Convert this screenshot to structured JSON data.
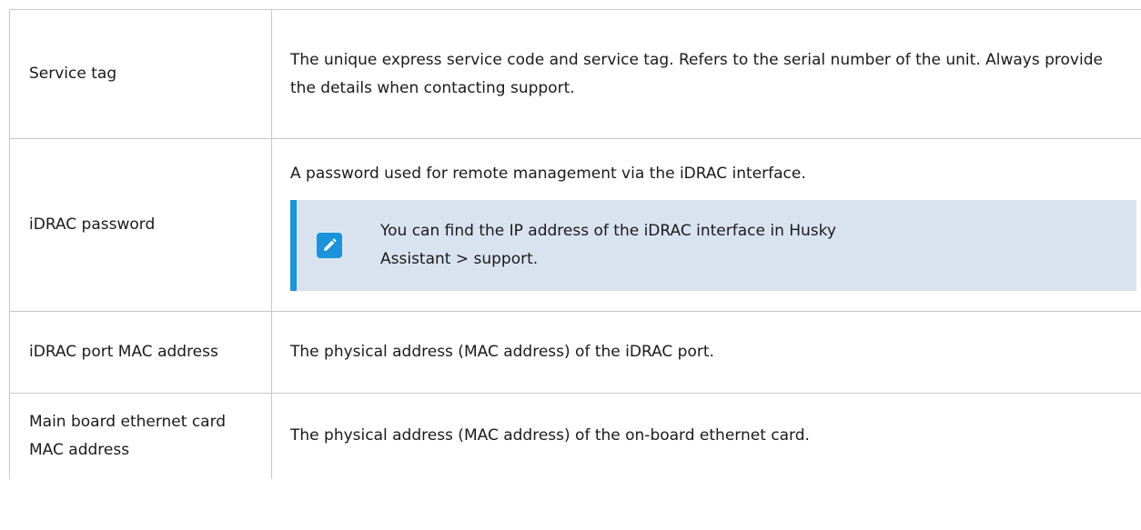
{
  "rows": [
    {
      "term": "Service tag",
      "description": "The unique express service code and service tag. Refers to the serial number of the unit. Always provide the details when contacting support."
    },
    {
      "term": "iDRAC password",
      "description": "A password used for remote management via the iDRAC interface.",
      "note": {
        "icon": "pencil-icon",
        "text": "You can find the IP address of the iDRAC interface in Husky Assistant > support."
      }
    },
    {
      "term": "iDRAC port MAC address",
      "description": "The physical address (MAC address) of the iDRAC port."
    },
    {
      "term": "Main board ethernet card MAC address",
      "description": "The physical address (MAC address) of the on-board ethernet card."
    }
  ],
  "colors": {
    "note_background": "#d9e3f0",
    "note_accent": "#1a93d8",
    "grid_border": "#c8c8c8"
  }
}
